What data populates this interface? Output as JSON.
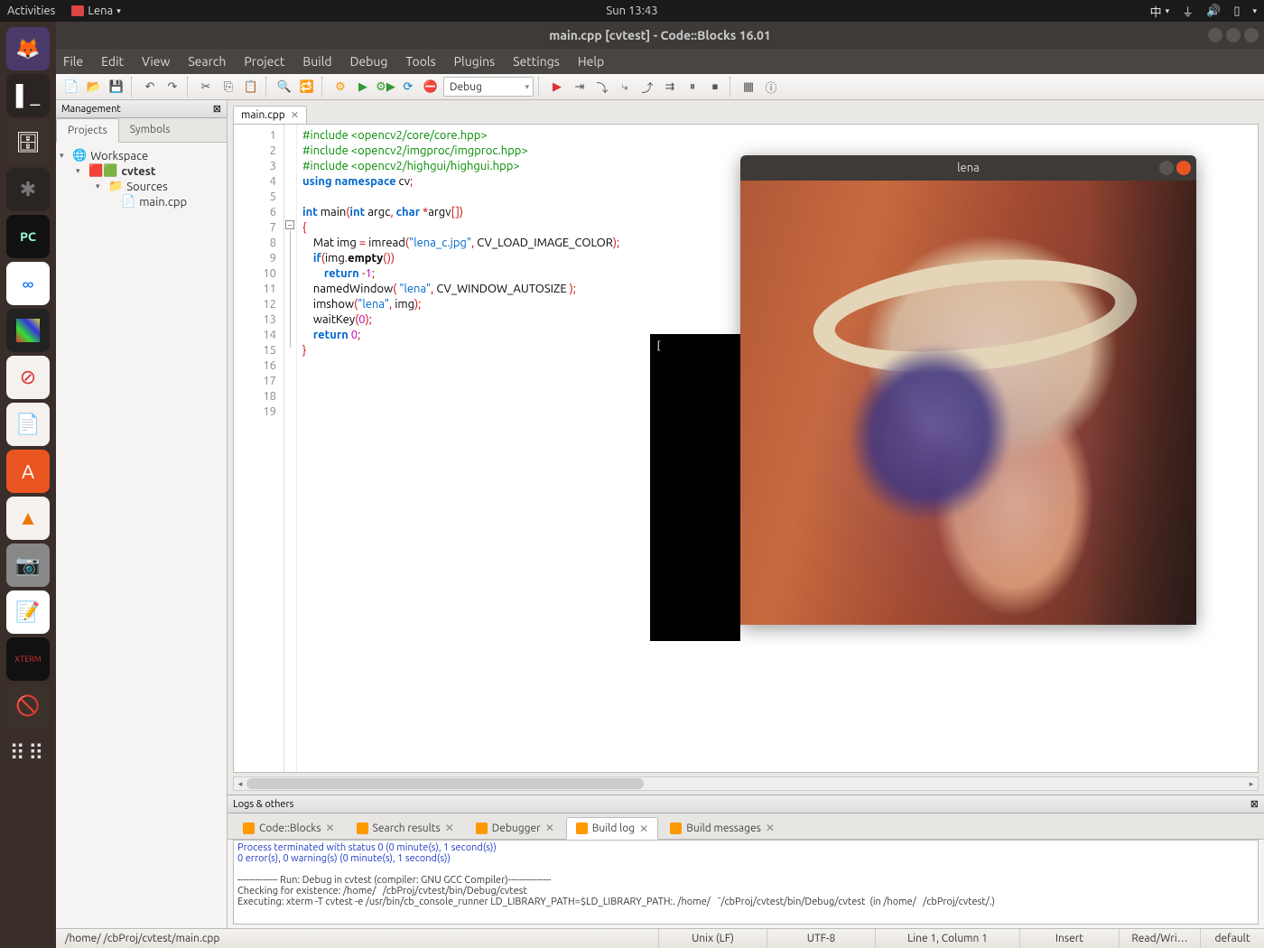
{
  "topbar": {
    "activities": "Activities",
    "app_name": "Lena",
    "clock": "Sun 13:43",
    "ime": "中"
  },
  "codeblocks": {
    "title": "main.cpp [cvtest] - Code::Blocks 16.01",
    "menu": [
      "File",
      "Edit",
      "View",
      "Search",
      "Project",
      "Build",
      "Debug",
      "Tools",
      "Plugins",
      "Settings",
      "Help"
    ],
    "build_config": "Debug",
    "management": {
      "title": "Management",
      "tabs": [
        "Projects",
        "Symbols"
      ],
      "active_tab": "Projects",
      "tree": {
        "workspace": "Workspace",
        "project": "cvtest",
        "folder": "Sources",
        "file": "main.cpp"
      }
    },
    "editor": {
      "tab": "main.cpp",
      "line_start": 1,
      "line_end": 19,
      "code_lines": [
        {
          "n": 1,
          "html": "<span class='pp'>#include &lt;opencv2/core/core.hpp&gt;</span>"
        },
        {
          "n": 2,
          "html": "<span class='pp'>#include &lt;opencv2/imgproc/imgproc.hpp&gt;</span>"
        },
        {
          "n": 3,
          "html": "<span class='pp'>#include &lt;opencv2/highgui/highgui.hpp&gt;</span>"
        },
        {
          "n": 4,
          "html": "<span class='kw'>using</span> <span class='kw'>namespace</span> cv<span class='op'>;</span>"
        },
        {
          "n": 5,
          "html": ""
        },
        {
          "n": 6,
          "html": "<span class='kw'>int</span> main<span class='op'>(</span><span class='kw'>int</span> argc<span class='op'>,</span> <span class='kw'>char</span> <span class='op'>*</span>argv<span class='op'>[])</span>"
        },
        {
          "n": 7,
          "html": "<span class='brace'>{</span>"
        },
        {
          "n": 8,
          "html": "    Mat img <span class='op'>=</span> imread<span class='op'>(</span><span class='str'>\"lena_c.jpg\"</span><span class='op'>,</span> CV_LOAD_IMAGE_COLOR<span class='op'>);</span>"
        },
        {
          "n": 9,
          "html": "    <span class='kw'>if</span><span class='op'>(</span>img<span class='op'>.</span><span class='fn' style='color:#000'>empty</span><span class='op'>())</span>"
        },
        {
          "n": 10,
          "html": "        <span class='kw'>return</span> <span class='op'>-</span><span class='num'>1</span><span class='op'>;</span>"
        },
        {
          "n": 11,
          "html": "    namedWindow<span class='op'>(</span> <span class='str'>\"lena\"</span><span class='op'>,</span> CV_WINDOW_AUTOSIZE <span class='op'>);</span>"
        },
        {
          "n": 12,
          "html": "    imshow<span class='op'>(</span><span class='str'>\"lena\"</span><span class='op'>,</span> img<span class='op'>);</span>"
        },
        {
          "n": 13,
          "html": "    waitKey<span class='op'>(</span><span class='num'>0</span><span class='op'>);</span>"
        },
        {
          "n": 14,
          "html": "    <span class='kw'>return</span> <span class='num'>0</span><span class='op'>;</span>"
        },
        {
          "n": 15,
          "html": "<span class='brace'>}</span>"
        },
        {
          "n": 16,
          "html": ""
        },
        {
          "n": 17,
          "html": ""
        },
        {
          "n": 18,
          "html": ""
        },
        {
          "n": 19,
          "html": ""
        }
      ]
    },
    "logs": {
      "title": "Logs & others",
      "tabs": [
        "Code::Blocks",
        "Search results",
        "Debugger",
        "Build log",
        "Build messages"
      ],
      "active_tab": "Build log",
      "lines": [
        {
          "cls": "logblue",
          "text": "Process terminated with status 0 (0 minute(s), 1 second(s))"
        },
        {
          "cls": "logblue",
          "text": "0 error(s), 0 warning(s) (0 minute(s), 1 second(s))"
        },
        {
          "cls": "logblue",
          "text": " "
        },
        {
          "cls": "",
          "text": ""
        },
        {
          "cls": "",
          "text": "-------------- Run: Debug in cvtest (compiler: GNU GCC Compiler)---------------"
        },
        {
          "cls": "",
          "text": ""
        },
        {
          "cls": "",
          "text": "Checking for existence: /home/   /cbProj/cvtest/bin/Debug/cvtest"
        },
        {
          "cls": "",
          "text": "Executing: xterm -T cvtest -e /usr/bin/cb_console_runner LD_LIBRARY_PATH=$LD_LIBRARY_PATH:. /home/   ˜/cbProj/cvtest/bin/Debug/cvtest  (in /home/   /cbProj/cvtest/.)"
        }
      ]
    },
    "status": {
      "path": "/home/     /cbProj/cvtest/main.cpp",
      "eol": "Unix (LF)",
      "encoding": "UTF-8",
      "cursor": "Line 1, Column 1",
      "mode": "Insert",
      "rw": "Read/Wri…",
      "profile": "default"
    }
  },
  "lena_window": {
    "title": "lena"
  }
}
